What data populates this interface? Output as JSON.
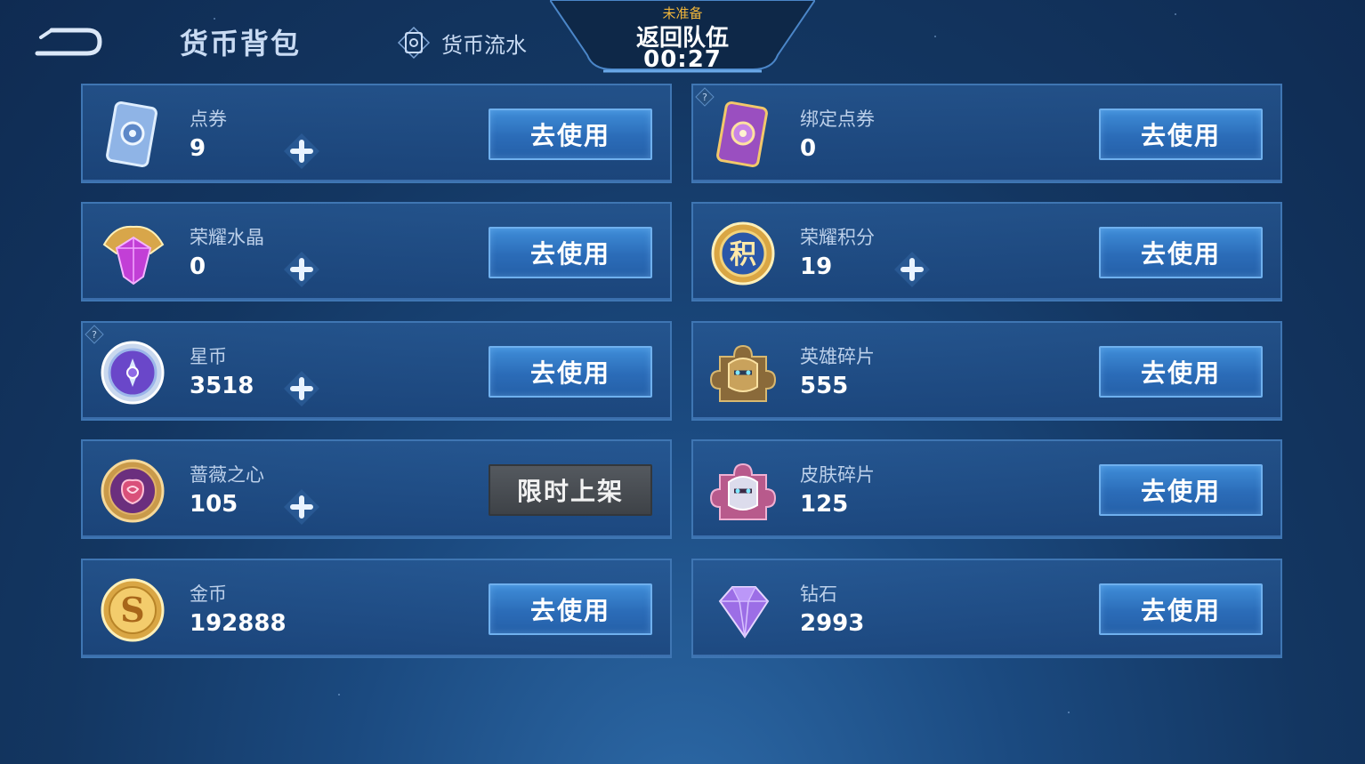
{
  "header": {
    "title": "货币背包",
    "flow_label": "货币流水"
  },
  "team": {
    "status": "未准备",
    "return_label": "返回队伍",
    "timer": "00:27"
  },
  "items": [
    {
      "name": "点券",
      "value": "9",
      "button": "去使用",
      "icon": "ticket-icon",
      "plus": true
    },
    {
      "name": "绑定点券",
      "value": "0",
      "button": "去使用",
      "icon": "bound-ticket-icon",
      "plus": false,
      "help": true
    },
    {
      "name": "荣耀水晶",
      "value": "0",
      "button": "去使用",
      "icon": "glory-crystal-icon",
      "plus": true
    },
    {
      "name": "荣耀积分",
      "value": "19",
      "button": "去使用",
      "icon": "glory-points-icon",
      "plus": true
    },
    {
      "name": "星币",
      "value": "3518",
      "button": "去使用",
      "icon": "star-coin-icon",
      "plus": true,
      "help": true
    },
    {
      "name": "英雄碎片",
      "value": "555",
      "button": "去使用",
      "icon": "hero-fragment-icon",
      "plus": false
    },
    {
      "name": "蔷薇之心",
      "value": "105",
      "button": "限时上架",
      "icon": "rose-heart-icon",
      "plus": true
    },
    {
      "name": "皮肤碎片",
      "value": "125",
      "button": "去使用",
      "icon": "skin-fragment-icon",
      "plus": false
    },
    {
      "name": "金币",
      "value": "192888",
      "button": "去使用",
      "icon": "gold-coin-icon",
      "plus": false
    },
    {
      "name": "钻石",
      "value": "2993",
      "button": "去使用",
      "icon": "diamond-icon",
      "plus": false
    }
  ],
  "colors": {
    "background": "#133661",
    "card_border": "#3f76b3",
    "button_blue": "#2b6cb8",
    "button_gray": "#4a4e53",
    "status_orange": "#f0b53a"
  }
}
